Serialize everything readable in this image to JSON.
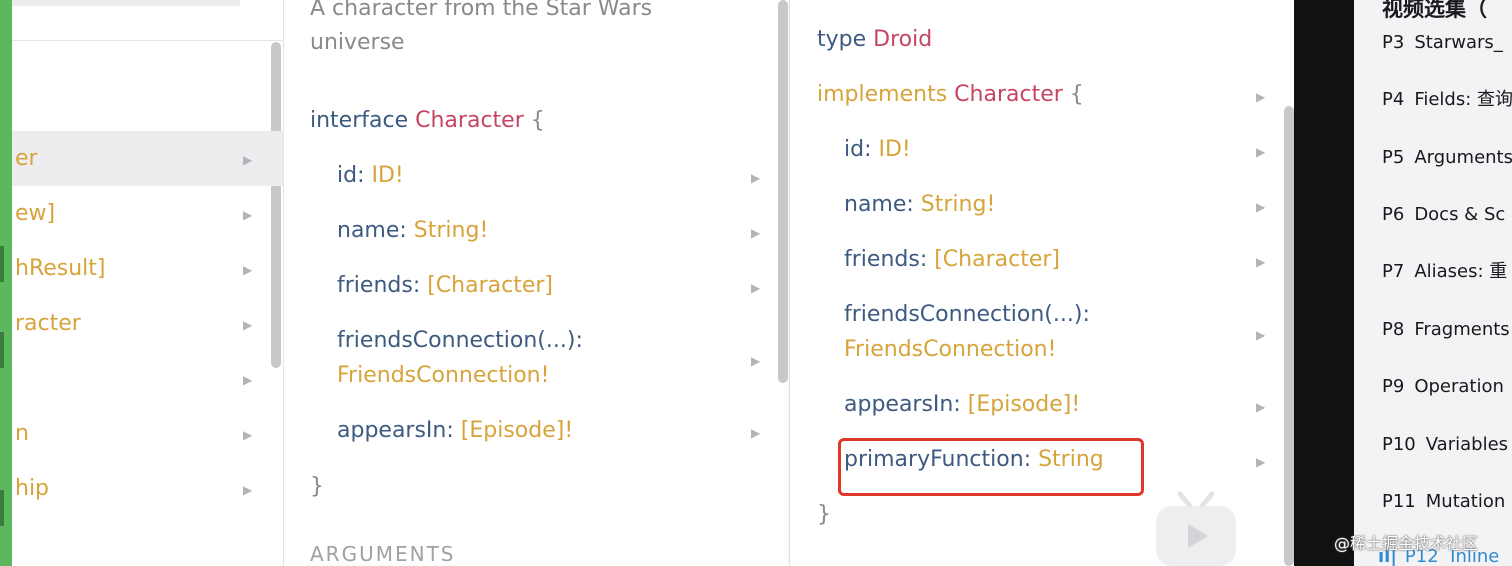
{
  "left_types": {
    "items": [
      {
        "label": "er",
        "color": "yellow",
        "selected": true
      },
      {
        "label": "ew]",
        "color": "yellow",
        "selected": false
      },
      {
        "label": "hResult]",
        "color": "yellow",
        "selected": false
      },
      {
        "label": "racter",
        "color": "yellow",
        "selected": false
      },
      {
        "label": "",
        "color": "yellow",
        "selected": false
      },
      {
        "label": "n",
        "color": "yellow",
        "selected": false
      },
      {
        "label": "hip",
        "color": "yellow",
        "selected": false
      }
    ]
  },
  "character_doc": {
    "description": "A character from the Star Wars universe",
    "interface_keyword": "interface",
    "interface_name": "Character",
    "open_brace": "{",
    "close_brace": "}",
    "fields": [
      {
        "name": "id",
        "sep": ": ",
        "type": "ID!"
      },
      {
        "name": "name",
        "sep": ": ",
        "type": "String!"
      },
      {
        "name": "friends",
        "sep": ": ",
        "type": "[Character]"
      },
      {
        "name": "friendsConnection(...)",
        "sep": ":",
        "type": "FriendsConnection!"
      },
      {
        "name": "appearsIn",
        "sep": ": ",
        "type": "[Episode]!"
      }
    ],
    "section_title": "ARGUMENTS"
  },
  "droid_doc": {
    "type_keyword": "type",
    "type_name": "Droid",
    "implements_keyword": "implements",
    "implements_name": "Character",
    "open_brace": "{",
    "close_brace": "}",
    "fields": [
      {
        "name": "id",
        "sep": ": ",
        "type": "ID!"
      },
      {
        "name": "name",
        "sep": ": ",
        "type": "String!"
      },
      {
        "name": "friends",
        "sep": ": ",
        "type": "[Character]"
      },
      {
        "name": "friendsConnection(...)",
        "sep": ":",
        "type": "FriendsConnection!"
      },
      {
        "name": "appearsIn",
        "sep": ": ",
        "type": "[Episode]!"
      },
      {
        "name": "primaryFunction",
        "sep": ": ",
        "type": "String",
        "highlighted": true
      }
    ]
  },
  "playlist": {
    "title": "视频选集（",
    "items": [
      {
        "num": "P3",
        "title": "Starwars_"
      },
      {
        "num": "P4",
        "title": "Fields: 查询"
      },
      {
        "num": "P5",
        "title": "Arguments"
      },
      {
        "num": "P6",
        "title": "Docs & Sc"
      },
      {
        "num": "P7",
        "title": "Aliases: 重"
      },
      {
        "num": "P8",
        "title": "Fragments"
      },
      {
        "num": "P9",
        "title": "Operation"
      },
      {
        "num": "P10",
        "title": "Variables"
      },
      {
        "num": "P11",
        "title": "Mutation"
      }
    ],
    "active": {
      "bars": "ıl|",
      "num": "P12",
      "title": "Inline"
    }
  },
  "watermark": "@稀土掘金技术社区",
  "colors": {
    "field_name": "#3d5a80",
    "type_ref": "#d6a43a",
    "type_name": "#c44662",
    "highlight_border": "#e0372c",
    "playlist_active": "#2f8ccf"
  }
}
